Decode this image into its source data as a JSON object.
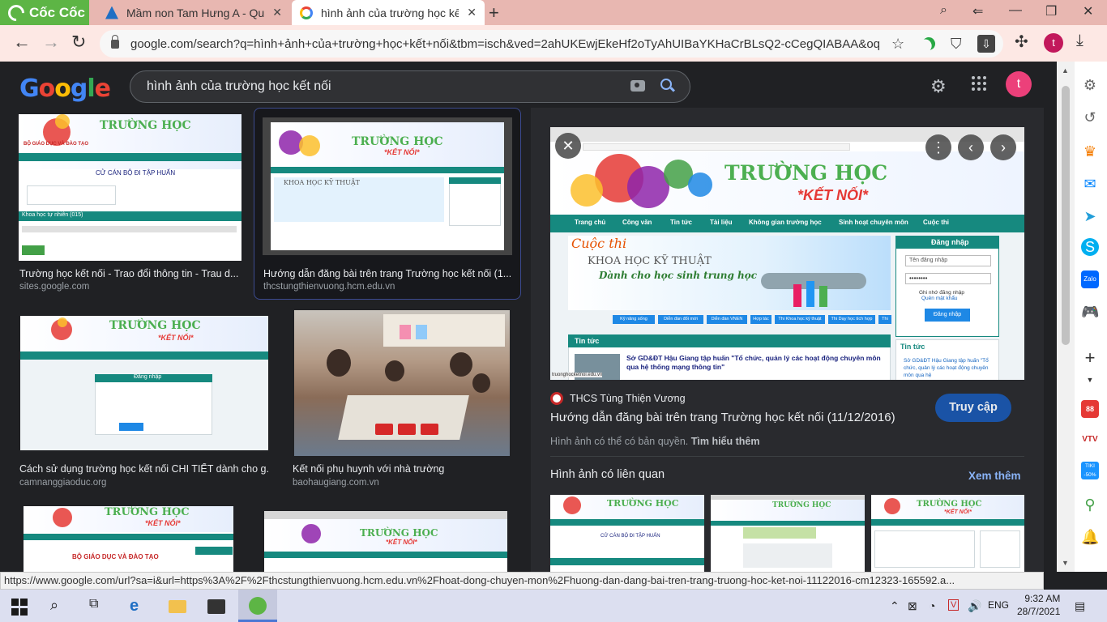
{
  "browser": {
    "brand": "Cốc Cốc",
    "tabs": [
      {
        "title": "Mầm non Tam Hưng A - Quả",
        "icon": "edge-icon"
      },
      {
        "title": "hình ảnh của trường học kết",
        "icon": "google-icon"
      }
    ],
    "url": "google.com/search?q=hình+ảnh+của+trường+học+kết+nối&tbm=isch&ved=2ahUKEwjEkeHf2oTyAhUIBaYKHaCrBLsQ2-cCegQIABAA&oq=hình+ả...",
    "profile_initial": "t"
  },
  "google": {
    "logo_text": "Google",
    "logo_colors": [
      "#4285f4",
      "#ea4335",
      "#fbbc05",
      "#4285f4",
      "#34a853",
      "#ea4335"
    ],
    "query": "hình ảnh của trường học kết nối",
    "profile_initial": "t"
  },
  "results": [
    {
      "title": "Trường học kết nối - Trao đổi thông tin - Trau d...",
      "source": "sites.google.com"
    },
    {
      "title": "Hướng dẫn đăng bài trên trang Trường học kết nối (1...",
      "source": "thcstungthienvuong.hcm.edu.vn"
    },
    {
      "title": "Cách sử dụng trường học kết nối CHI TIẾT dành cho g...",
      "source": "camnanggiaoduc.org"
    },
    {
      "title": "Kết nối phụ huynh với nhà trường",
      "source": "baohaugiang.com.vn"
    }
  ],
  "thumb_text": {
    "truong_hoc": "TRƯỜNG HỌC",
    "ket_noi": "*KẾT NỐI*",
    "bo_gd": "BỘ GIÁO DỤC VÀ ĐÀO TẠO",
    "cu_can_bo": "CỬ CÁN BỘ ĐI TẬP HUẤN",
    "khoa_hoc": "Khoa học tự nhiên (015)",
    "dang_nhap": "Đăng nhập",
    "cuoc_thi": "Cuộc thi",
    "khkt": "KHOA HỌC KỸ THUẬT",
    "danh_cho": "Dành cho học sinh trung học"
  },
  "preview": {
    "nav_items": [
      "Trang chủ",
      "Công văn",
      "Tin tức",
      "Tài liệu",
      "Không gian trường học",
      "Sinh hoạt chuyên môn",
      "Cuộc thi"
    ],
    "login_title": "Đăng nhập",
    "login_user_placeholder": "Tên đăng nhập",
    "login_password_mask": "••••••••",
    "remember": "Ghi nhớ đăng nhập",
    "forgot": "Quên mật khẩu",
    "login_button": "Đăng nhập",
    "news_title": "Tin tức",
    "news_headline": "Sở GD&ĐT Hậu Giang tập huấn \"Tổ chức, quản lý các hoạt động chuyên môn qua hệ thống mạng thông tin\"",
    "side_news_title": "Tin tức",
    "side_news_text": "Sở GD&ĐT Hậu Giang tập huấn \"Tổ chức, quản lý các hoạt động chuyên môn qua hệ",
    "tags": [
      "Kỹ năng sống",
      "Diễn đàn đổi mới",
      "Diễn đàn VNEN",
      "Hợp tác",
      "Thi Khoa học kỹ thuật",
      "Thi Dạy học tích hợp",
      "Thi Kiến thức liên môn"
    ],
    "footer_url": "truonghocketnoi.edu.vn",
    "site_name": "THCS Tùng Thiện Vương",
    "title": "Hướng dẫn đăng bài trên trang Trường học kết nối (11/12/2016)",
    "visit": "Truy cập",
    "copyright": "Hình ảnh có thể có bản quyền.",
    "learn_more": "Tìm hiểu thêm",
    "related_heading": "Hình ảnh có liên quan",
    "see_more": "Xem thêm"
  },
  "status_url": "https://www.google.com/url?sa=i&url=https%3A%2F%2Fthcstungthienvuong.hcm.edu.vn%2Fhoat-dong-chuyen-mon%2Fhuong-dan-dang-bai-tren-trang-truong-hoc-ket-noi-11122016-cm12323-165592.a...",
  "taskbar": {
    "language": "ENG",
    "time": "9:32 AM",
    "date": "28/7/2021"
  },
  "side_badges": {
    "tiki": "TIKI -50%",
    "mail_count": "88"
  }
}
